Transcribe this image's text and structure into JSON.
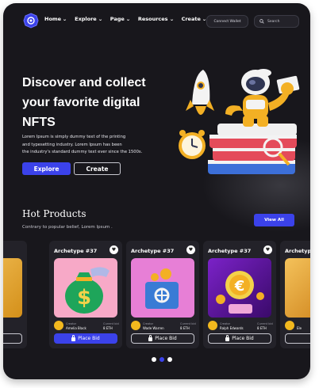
{
  "nav": {
    "items": [
      {
        "label": "Home"
      },
      {
        "label": "Explore"
      },
      {
        "label": "Page"
      },
      {
        "label": "Resources"
      },
      {
        "label": "Create"
      }
    ],
    "connect_label": "Connect Wallet",
    "search_placeholder": "Search"
  },
  "hero": {
    "title_line1": "Discover and collect",
    "title_line2": "your favorite digital",
    "title_line3": "NFTS",
    "desc_line1": "Lorem Ipsum is simply dummy text of the printing",
    "desc_line2": "and typesetting industry. Lorem Ipsum has been",
    "desc_line3": "the industry's standard dummy text ever since the 1500s.",
    "explore_label": "Explore",
    "create_label": "Create"
  },
  "hot": {
    "title": "Hot Products",
    "subtitle": "Contrary to popular belief, Lorem Ipsum .",
    "view_all_label": "View All"
  },
  "cards": [
    {
      "title": "Archetype #37",
      "creator_label": "Creator",
      "creator": "Amelia Black",
      "bid_label": "Current bid",
      "bid": "8 ETH",
      "button": "Place Bid",
      "primary": true
    },
    {
      "title": "Archetype #37",
      "creator_label": "Creator",
      "creator": "Wade Warren",
      "bid_label": "Current bid",
      "bid": "8 ETH",
      "button": "Place Bid",
      "primary": false
    },
    {
      "title": "Archetype #37",
      "creator_label": "Creator",
      "creator": "Ralph Edwards",
      "bid_label": "Current bid",
      "bid": "8 ETH",
      "button": "Place Bid",
      "primary": false
    },
    {
      "title": "Archetype",
      "creator": "Ele"
    }
  ],
  "colors": {
    "background": "#18171c",
    "accent": "#3b42ea",
    "card": "#232229"
  }
}
